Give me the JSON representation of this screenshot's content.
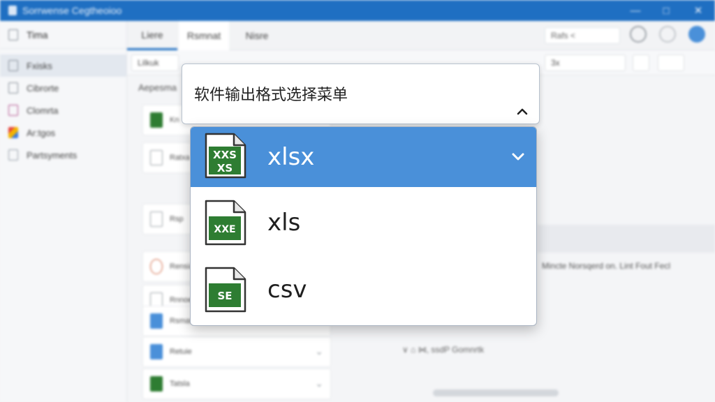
{
  "window": {
    "title": "Sоrrwense Cegtheoioo"
  },
  "window_controls": {
    "minimize": "—",
    "maximize": "□",
    "close": "✕"
  },
  "sidebar": {
    "top": "Tima",
    "items": [
      {
        "label": "Fxisks",
        "icon": "file-icon"
      },
      {
        "label": "Cibrorte",
        "icon": "file-icon"
      },
      {
        "label": "Clomrta",
        "icon": "contact-icon"
      },
      {
        "label": "Ar:tgos",
        "icon": "apps-icon"
      },
      {
        "label": "Partsyments",
        "icon": "document-icon"
      }
    ]
  },
  "tabs": [
    {
      "label": "Liere"
    },
    {
      "label": "Rsmnat"
    },
    {
      "label": "Nisre"
    }
  ],
  "search": {
    "value": "Rafs <"
  },
  "toolbar": {
    "select_left": "Lilkuk",
    "select_right": "3x"
  },
  "list_panel": {
    "header": "Aepesma",
    "rows": [
      "Kn",
      "Ratxa",
      "Rsp",
      "Rensia",
      "Rnnoe",
      "Rsmas",
      "Retuie",
      "",
      "Tatsla"
    ]
  },
  "right_panel": {
    "info": "Mincte Norsqerd on. Lint Fout Fecl",
    "tree": "∨  ⌂  ⋈, ssdP Gomnrtk"
  },
  "combo": {
    "label": "软件输出格式选择菜单",
    "caret_icon": "chevron-up-icon",
    "selected": "xlsx"
  },
  "dropdown": {
    "options": [
      {
        "label": "xlsx",
        "icon_text_top": "XXS",
        "icon_text_bottom": "XS",
        "selected": true
      },
      {
        "label": "xls",
        "icon_text": "XXE",
        "selected": false
      },
      {
        "label": "csv",
        "icon_text": "SE",
        "selected": false
      }
    ]
  },
  "colors": {
    "accent": "#4a90d9",
    "titlebar": "#1f6fc2",
    "excel_green": "#2e7d32",
    "icon_outline": "#333333"
  }
}
